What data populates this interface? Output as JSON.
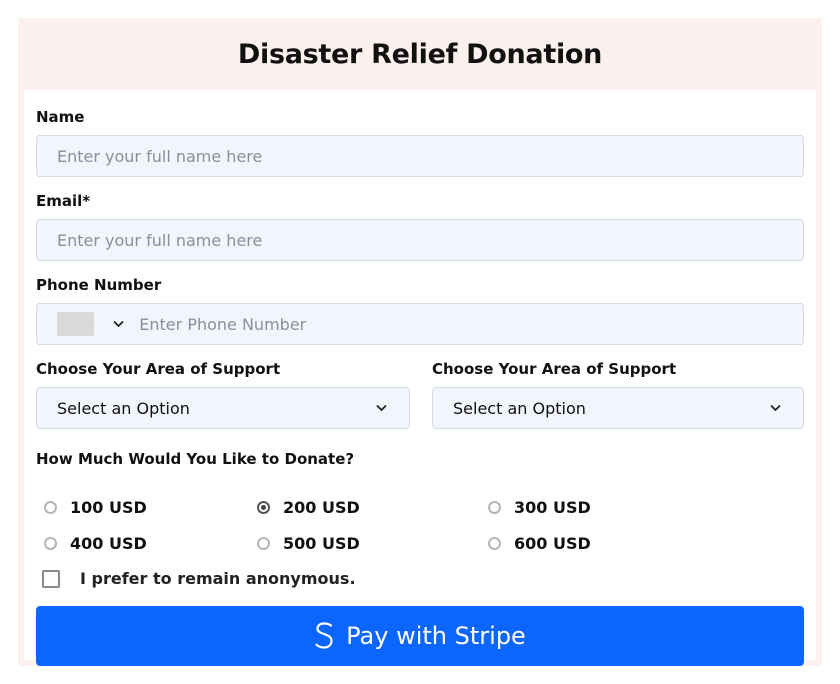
{
  "title": "Disaster Relief Donation",
  "name_field": {
    "label": "Name",
    "placeholder": "Enter your full name here"
  },
  "email_field": {
    "label": "Email*",
    "placeholder": "Enter your full name here"
  },
  "phone_field": {
    "label": "Phone Number",
    "placeholder": "Enter Phone Number"
  },
  "support_left": {
    "label": "Choose Your Area of Support",
    "value": "Select an Option"
  },
  "support_right": {
    "label": "Choose Your Area of Support",
    "value": "Select an Option"
  },
  "donation": {
    "label": "How Much Would You Like to Donate?",
    "options": [
      "100 USD",
      "200 USD",
      "300 USD",
      "400 USD",
      "500 USD",
      "600 USD"
    ],
    "selected": "200 USD"
  },
  "anonymous": {
    "label": "I prefer to remain anonymous.",
    "checked": false
  },
  "pay_button": {
    "label": "Pay with Stripe",
    "icon": "stripe-s-icon"
  },
  "colors": {
    "accent": "#0a66ff",
    "frame": "#fdf1ef",
    "field_bg": "#f3f5fc"
  }
}
